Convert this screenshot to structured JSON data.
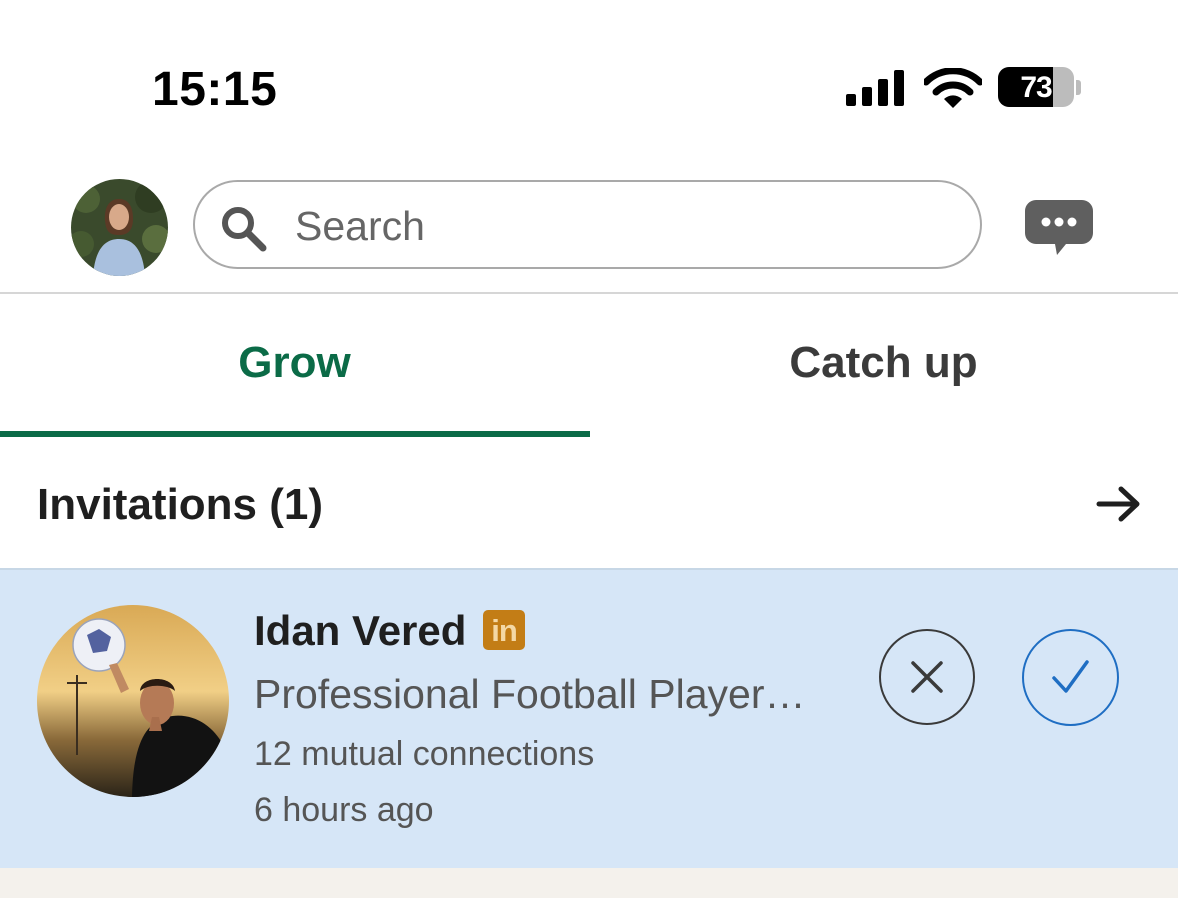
{
  "status_bar": {
    "time": "15:15",
    "battery_level": "73",
    "battery_fraction": 0.73
  },
  "header": {
    "avatar_icon": "profile-photo",
    "search_placeholder": "Search",
    "search_icon": "search-icon",
    "messaging_icon": "chat-bubble-icon"
  },
  "tabs": [
    {
      "label": "Grow",
      "selected": true
    },
    {
      "label": "Catch up",
      "selected": false
    }
  ],
  "invitations": {
    "title": "Invitations (1)",
    "arrow_icon": "arrow-right-icon",
    "items": [
      {
        "name": "Idan Vered",
        "premium_badge": "in",
        "headline": "Professional Football Player…",
        "mutual": "12 mutual connections",
        "time": "6 hours ago",
        "ignore_icon": "close-icon",
        "accept_icon": "checkmark-icon"
      }
    ]
  },
  "colors": {
    "accent_green": "#0b6b47",
    "card_highlight": "#d6e6f7",
    "accept_blue": "#1f6ec3",
    "premium_gold": "#c37d16"
  }
}
